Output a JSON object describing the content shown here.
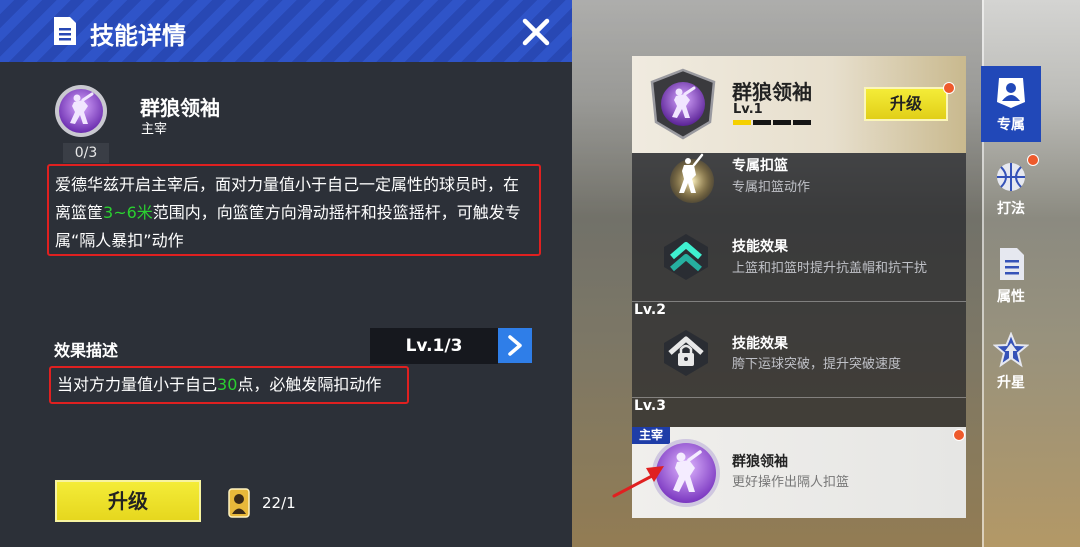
{
  "detail": {
    "title": "技能详情",
    "skill_name": "群狼领袖",
    "skill_type": "主宰",
    "progress": "0/3",
    "description": {
      "before": "爱德华兹开启主宰后，面对力量值小于自己一定属性的球员时，在离篮筐",
      "highlight": "3~6米",
      "after": "范围内，向篮筐方向滑动摇杆和投篮摇杆，可触发专属“隔人暴扣”动作"
    },
    "effect_title": "效果描述",
    "level_label": "Lv.1/3",
    "effect": {
      "before": "当对方力量值小于自己",
      "highlight": "30",
      "after": "点，必触发隔扣动作"
    },
    "upgrade_label": "升级",
    "card_count": "22/1"
  },
  "tree": {
    "title": "群狼领袖",
    "level": "Lv.1",
    "level_progress": 0.25,
    "upgrade_label": "升级",
    "nodes": [
      {
        "name": "专属扣篮",
        "desc": "专属扣篮动作",
        "icon": "dunk-player-icon"
      },
      {
        "name": "技能效果",
        "desc": "上篮和扣篮时提升抗盖帽和抗干扰",
        "icon": "chevron-up-icon"
      },
      {
        "name": "技能效果",
        "desc": "胯下运球突破，提升突破速度",
        "icon": "lock-icon"
      }
    ],
    "level_labels": [
      "Lv.2",
      "Lv.3"
    ],
    "active": {
      "tag": "主宰",
      "name": "群狼领袖",
      "desc": "更好操作出隔人扣篮"
    }
  },
  "nav": [
    {
      "label": "专属",
      "icon": "player-badge-icon",
      "active": true
    },
    {
      "label": "打法",
      "icon": "basketball-icon",
      "active": false
    },
    {
      "label": "属性",
      "icon": "document-icon",
      "active": false
    },
    {
      "label": "升星",
      "icon": "star-icon",
      "active": false
    }
  ],
  "colors": {
    "accent_blue": "#2148b8",
    "highlight_green": "#2ad030",
    "button_yellow": "#f4ec38",
    "annotation_red": "#e02020"
  }
}
